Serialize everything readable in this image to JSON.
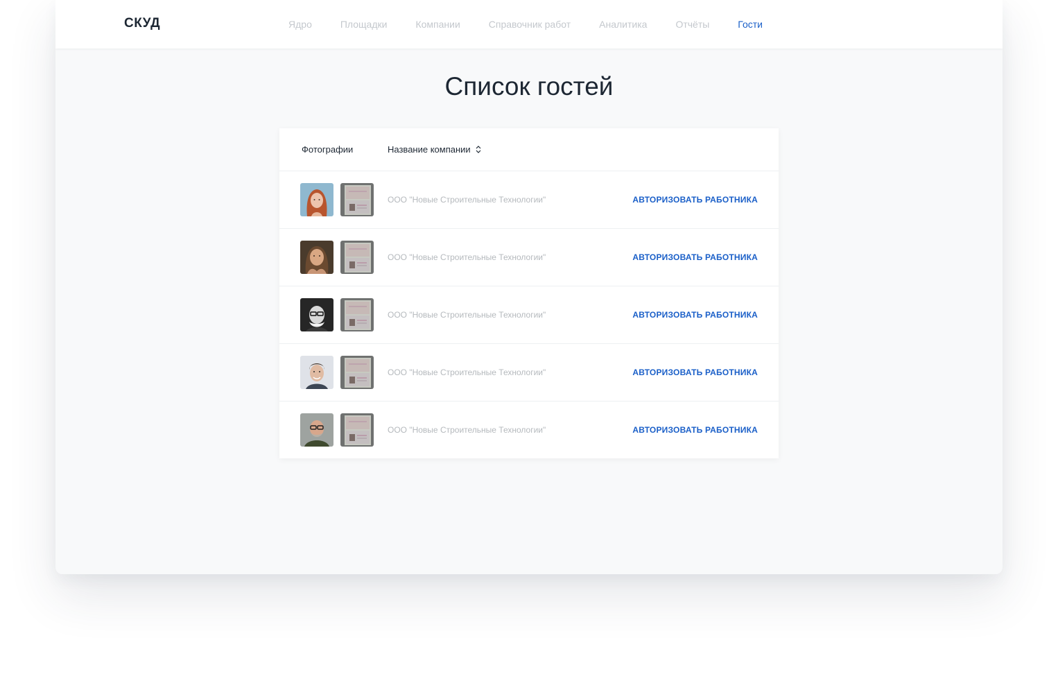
{
  "header": {
    "logo": "СКУД",
    "nav": [
      "Ядро",
      "Площадки",
      "Компании",
      "Справочник работ",
      "Аналитика",
      "Отчёты",
      "Гости"
    ],
    "active_nav": "Гости"
  },
  "page_title": "Список гостей",
  "table": {
    "col_photos": "Фотографии",
    "col_company": "Название компании",
    "rows": [
      {
        "company": "ООО \"Новые Строительные Технологии\"",
        "action": "АВТОРИЗОВАТЬ РАБОТНИКА",
        "avatar": "woman-red-hair-photo"
      },
      {
        "company": "ООО \"Новые Строительные Технологии\"",
        "action": "АВТОРИЗОВАТЬ РАБОТНИКА",
        "avatar": "woman-hand-on-chin-photo"
      },
      {
        "company": "ООО \"Новые Строительные Технологии\"",
        "action": "АВТОРИЗОВАТЬ РАБОТНИКА",
        "avatar": "bald-man-glasses-bw-photo"
      },
      {
        "company": "ООО \"Новые Строительные Технологии\"",
        "action": "АВТОРИЗОВАТЬ РАБОТНИКА",
        "avatar": "young-man-smiling-photo"
      },
      {
        "company": "ООО \"Новые Строительные Технологии\"",
        "action": "АВТОРИЗОВАТЬ РАБОТНИКА",
        "avatar": "bald-man-glasses-photo"
      }
    ]
  },
  "colors": {
    "accent": "#1a5fc8",
    "text_dark": "#1d2733",
    "text_muted": "#b5b9bd",
    "background": "#f8f9fa"
  }
}
